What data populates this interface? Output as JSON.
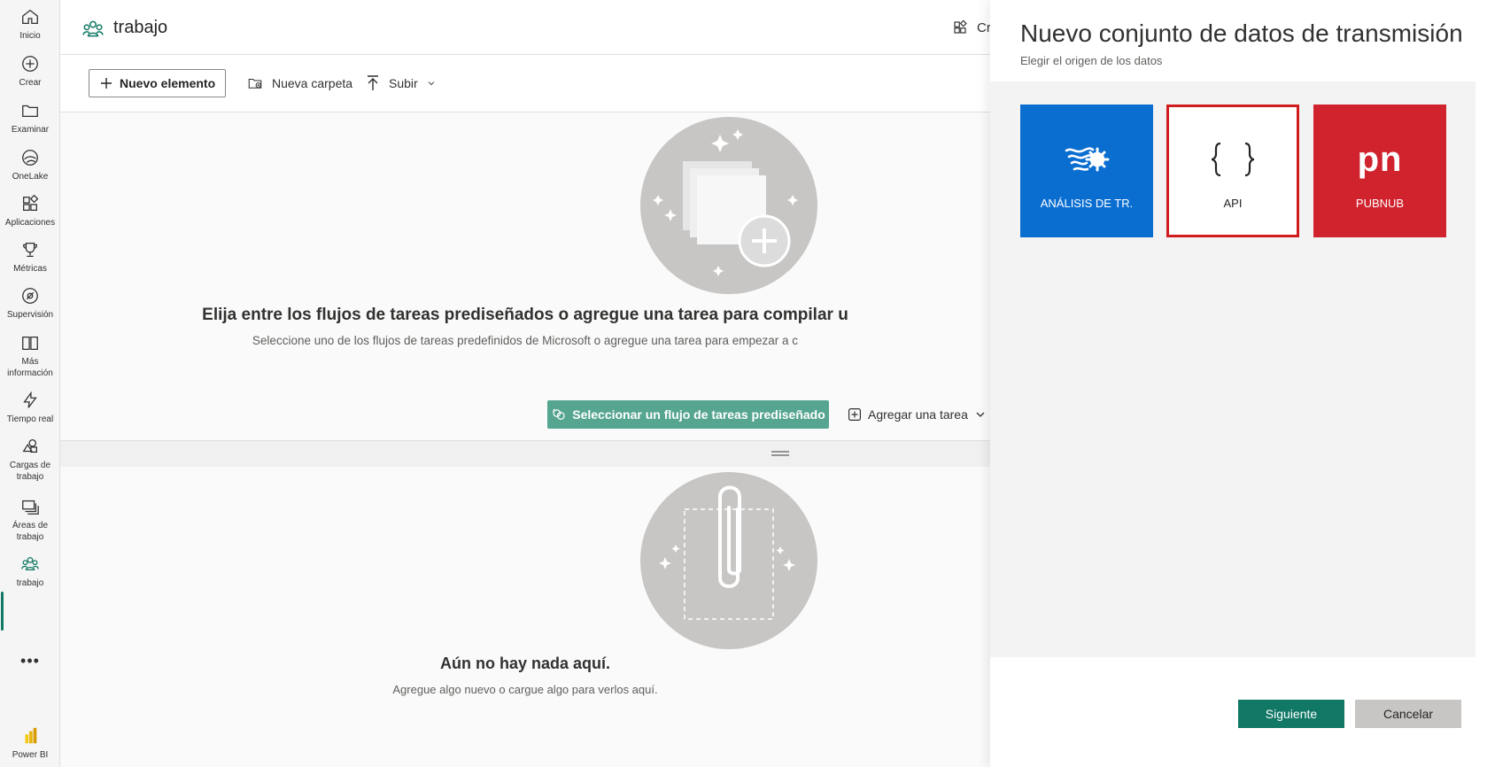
{
  "rail": {
    "items": [
      {
        "label": "Inicio",
        "icon": "home-icon"
      },
      {
        "label": "Crear",
        "icon": "create-icon"
      },
      {
        "label": "Examinar",
        "icon": "folder-icon"
      },
      {
        "label": "OneLake",
        "icon": "onelake-icon"
      },
      {
        "label": "Aplicaciones",
        "icon": "apps-icon"
      },
      {
        "label": "Métricas",
        "icon": "trophy-icon"
      },
      {
        "label": "Supervisión",
        "icon": "monitor-icon"
      },
      {
        "label": "Más información",
        "icon": "book-icon"
      },
      {
        "label": "Tiempo real",
        "icon": "lightning-icon"
      },
      {
        "label": "Cargas de trabajo",
        "icon": "workloads-icon"
      },
      {
        "label": "Áreas de trabajo",
        "icon": "workspaces-icon"
      },
      {
        "label": "trabajo",
        "icon": "workspace-people-icon"
      }
    ],
    "more": "•••",
    "powerbi_label": "Power BI"
  },
  "header": {
    "workspace_title": "trabajo",
    "create_label": "Cre"
  },
  "toolbar": {
    "new_item": "Nuevo elemento",
    "new_folder": "Nueva carpeta",
    "upload": "Subir"
  },
  "main": {
    "heading": "Elija entre los flujos de tareas prediseñados o agregue una tarea para compilar u",
    "subheading": "Seleccione uno de los flujos de tareas predefinidos de Microsoft o agregue una tarea para empezar a c",
    "prebuilt_button": "Seleccionar un flujo de tareas prediseñado",
    "add_task": "Agregar una tarea",
    "empty_title": "Aún no hay nada aquí.",
    "empty_sub": "Agregue algo nuevo o cargue algo para verlos aquí."
  },
  "panel": {
    "title": "Nuevo conjunto de datos de transmisión",
    "subtitle": "Elegir el origen de los datos",
    "tiles": [
      {
        "label": "ANÁLISIS DE TR.",
        "icon": "azure-stream-analytics-icon",
        "color": "#0a6ed1"
      },
      {
        "label": "API",
        "icon": "api-braces-icon",
        "color": "#ffffff",
        "selected": true
      },
      {
        "label": "PUBNUB",
        "icon": "pubnub-icon",
        "color": "#d0232e",
        "logo_text": "pn"
      }
    ],
    "next_button": "Siguiente",
    "cancel_button": "Cancelar"
  },
  "colors": {
    "accent": "#117865",
    "prebuilt_button": "#55a590",
    "selected_border": "#d01c1f"
  }
}
